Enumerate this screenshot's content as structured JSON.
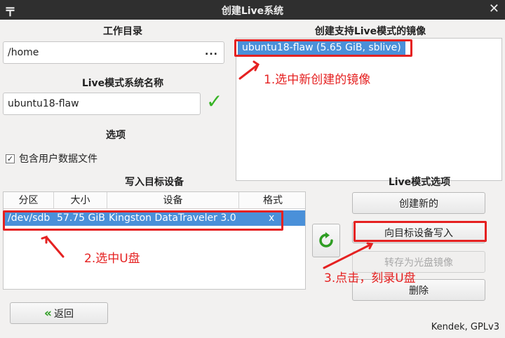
{
  "window": {
    "title": "创建Live系统",
    "menu_icon": "menu-icon",
    "close_icon": "close-icon",
    "menu_glyph": "〒",
    "close_glyph": "✕"
  },
  "left": {
    "workdir_label": "工作目录",
    "workdir_value": "/home",
    "workdir_browse": "...",
    "live_name_label": "Live模式系统名称",
    "live_name_value": "ubuntu18-flaw",
    "valid_glyph": "✓",
    "options_label": "选项",
    "include_user_data_label": "包含用户数据文件",
    "include_user_data_checked": true,
    "checked_glyph": "✓"
  },
  "images": {
    "label": "创建支持Live模式的镜像",
    "items": [
      "ubuntu18-flaw (5.65 GiB, sblive)"
    ]
  },
  "devices": {
    "label": "写入目标设备",
    "headers": [
      "分区",
      "大小",
      "设备",
      "格式"
    ],
    "rows": [
      {
        "partition": "/dev/sdb",
        "size": "57.75 GiB",
        "device": "Kingston DataTraveler 3.0",
        "format": "x"
      }
    ]
  },
  "live_options": {
    "label": "Live模式选项",
    "create_new": "创建新的",
    "write_to_device": "向目标设备写入",
    "save_as_iso": "转存为光盘镜像",
    "delete": "删除"
  },
  "back_button": {
    "label": "返回",
    "icon_glyph": "«"
  },
  "footer_text": "Kendek, GPLv3",
  "annotations": {
    "step1": "1.选中新创建的镜像",
    "step2": "2.选中U盘",
    "step3": "3.点击，刻录U盘"
  },
  "colors": {
    "selection": "#4a90d9",
    "annotation": "#e52121",
    "valid_check": "#36b324",
    "refresh_icon": "#2e9d23",
    "back_icon": "#2e9d23"
  }
}
